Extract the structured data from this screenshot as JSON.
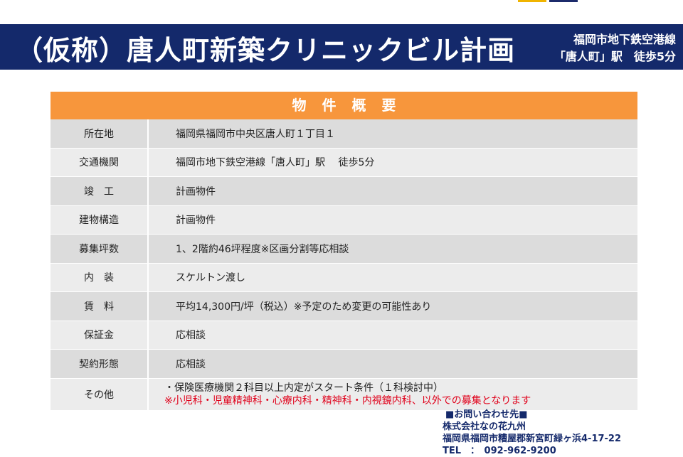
{
  "header": {
    "title": "（仮称）唐人町新築クリニックビル計画",
    "station_line1": "福岡市地下鉄空港線",
    "station_line2": "「唐人町」駅　徒歩5分"
  },
  "table": {
    "heading": "物件概要",
    "rows": [
      {
        "label": "所在地",
        "value": "福岡県福岡市中央区唐人町１丁目１"
      },
      {
        "label": "交通機関",
        "value": "福岡市地下鉄空港線「唐人町」駅　 徒歩5分"
      },
      {
        "label": "竣　工",
        "value": "計画物件"
      },
      {
        "label": "建物構造",
        "value": "計画物件"
      },
      {
        "label": "募集坪数",
        "value": "1、2階約46坪程度※区画分割等応相談"
      },
      {
        "label": "内　装",
        "value": "スケルトン渡し"
      },
      {
        "label": "賃　料",
        "value": "平均14,300円/坪（税込）※予定のため変更の可能性あり"
      },
      {
        "label": "保証金",
        "value": "応相談"
      },
      {
        "label": "契約形態",
        "value": "応相談"
      },
      {
        "label": "その他",
        "value": "・保険医療機関２科目以上内定がスタート条件（１科検討中）",
        "note": "※小児科・児童精神科・心療内科・精神科・内視鏡内科、以外での募集となります"
      }
    ]
  },
  "contact": {
    "heading": "■お問い合わせ先■",
    "company": "株式会社なの花九州",
    "address": "福岡県福岡市糟屋郡新宮町緑ヶ浜4-17-22",
    "tel": "TEL　：　092-962-9200"
  },
  "colors": {
    "header_bg": "#14296b",
    "table_heading_bg": "#f7963c",
    "note_red": "#e0001a"
  }
}
